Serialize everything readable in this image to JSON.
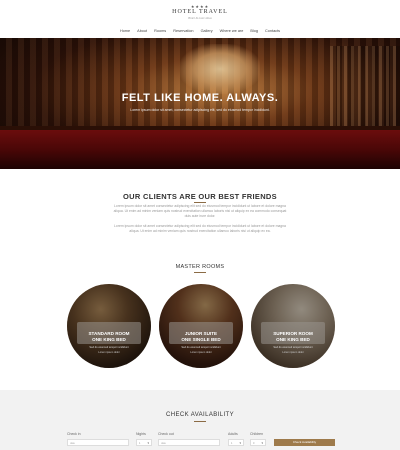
{
  "header": {
    "stars": "★★★★",
    "logo": "HOTEL TRAVEL",
    "tagline": "Hotel & more ideas",
    "nav": [
      "Home",
      "About",
      "Rooms",
      "Reservation",
      "Gallery",
      "Where we are",
      "Blog",
      "Contacts"
    ]
  },
  "hero": {
    "title": "FELT LIKE HOME. ALWAYS.",
    "subtitle": "Lorem ipsum dolor sit amet, consectetur adipiscing elit, sed do eiusmod tempor incididunt."
  },
  "clients": {
    "title": "OUR CLIENTS ARE OUR BEST FRIENDS",
    "text1": "Lorem ipsum dolor sit amet consectetur adipiscing elit sed do eiusmod tempor incididunt ut labore et dolore magna aliqua. Ut enim ad minim veniam quis nostrud exercitation ullamco laboris nisi ut aliquip ex ea commodo consequat duis aute irure dolor.",
    "text2": "Lorem ipsum dolor sit amet consectetur adipiscing elit sed do eiusmod tempor incididunt ut labore et dolore magna aliqua. Ut enim ad minim veniam quis nostrud exercitation ullamco laboris nisi ut aliquip ex ea."
  },
  "rooms": {
    "title": "MASTER ROOMS",
    "items": [
      {
        "line1": "STANDARD ROOM",
        "line2": "ONE KING BED",
        "desc": "Sed do eiusmod tempor incididunt",
        "more": "Lorem ipsum dolor"
      },
      {
        "line1": "JUNIOR SUITE",
        "line2": "ONE SINGLE BED",
        "desc": "Sed do eiusmod tempor incididunt",
        "more": "Lorem ipsum dolor"
      },
      {
        "line1": "SUPERIOR ROOM",
        "line2": "ONE KING BED",
        "desc": "Sed do eiusmod tempor incididunt",
        "more": "Lorem ipsum dolor"
      }
    ]
  },
  "availability": {
    "title": "CHECK AVAILABILITY",
    "checkin_label": "Check in",
    "checkin_placeholder": "date",
    "nights_label": "Nights",
    "nights_value": "1",
    "checkout_label": "Check out",
    "checkout_placeholder": "date",
    "adults_label": "Adults",
    "adults_value": "1",
    "children_label": "Children",
    "children_value": "0",
    "button": "Check Availability"
  },
  "colors": {
    "accent": "#9e7a4b",
    "hero_red": "#6b0d0d"
  }
}
